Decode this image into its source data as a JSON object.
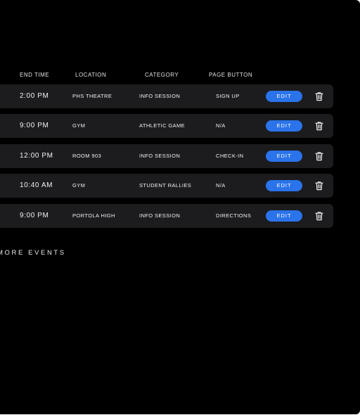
{
  "columns": {
    "end_time": "END TIME",
    "location": "LOCATION",
    "category": "CATEGORY",
    "page_button": "PAGE BUTTON"
  },
  "events": [
    {
      "end_time": "2:00 PM",
      "location": "PHS THEATRE",
      "category": "INFO SESSION",
      "page_button": "SIGN UP",
      "edit_label": "EDIT"
    },
    {
      "end_time": "9:00 PM",
      "location": "GYM",
      "category": "ATHLETIC GAME",
      "page_button": "N/A",
      "edit_label": "EDIT"
    },
    {
      "end_time": "12:00 PM",
      "location": "ROOM 903",
      "category": "INFO SESSION",
      "page_button": "CHECK-IN",
      "edit_label": "EDIT"
    },
    {
      "end_time": "10:40 AM",
      "location": "GYM",
      "category": "STUDENT RALLIES",
      "page_button": "N/A",
      "edit_label": "EDIT"
    },
    {
      "end_time": "9:00 PM",
      "location": "PORTOLA HIGH",
      "category": "INFO SESSION",
      "page_button": "DIRECTIONS",
      "edit_label": "EDIT"
    }
  ],
  "more_events_label": "MORE EVENTS",
  "icons": {
    "delete": "trash-icon"
  },
  "colors": {
    "background": "#000000",
    "row_background": "#1c1c1e",
    "accent": "#2a73ea",
    "text": "#f2f2f2"
  }
}
